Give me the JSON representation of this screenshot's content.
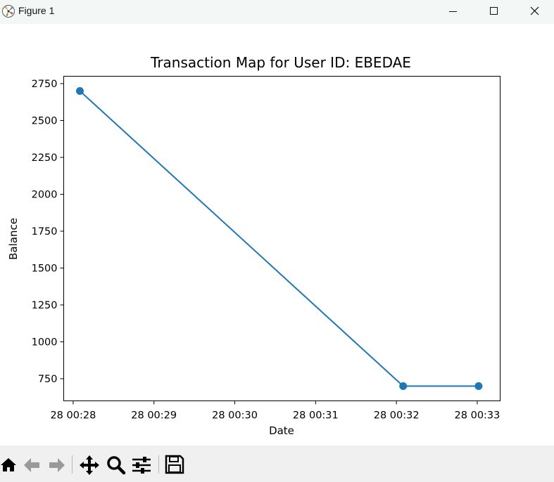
{
  "window": {
    "title": "Figure 1",
    "controls": {
      "minimize": "minimize-icon",
      "maximize": "maximize-icon",
      "close": "close-icon"
    }
  },
  "toolbar": {
    "tools": [
      {
        "id": "home",
        "icon": "home-icon"
      },
      {
        "id": "back",
        "icon": "arrow-left-icon"
      },
      {
        "id": "forward",
        "icon": "arrow-right-icon"
      },
      {
        "id": "pan",
        "icon": "move-icon"
      },
      {
        "id": "zoom",
        "icon": "magnifier-icon"
      },
      {
        "id": "configure",
        "icon": "sliders-icon"
      },
      {
        "id": "save",
        "icon": "floppy-disk-icon"
      }
    ]
  },
  "chart_data": {
    "type": "line",
    "title": "Transaction Map for User ID: EBEDAE",
    "xlabel": "Date",
    "ylabel": "Balance",
    "x": [
      "28 00:28:05",
      "28 00:32:05",
      "28 00:33:01"
    ],
    "series": [
      {
        "values": [
          2700,
          700,
          700
        ],
        "color": "#1f77b4",
        "marker": "circle"
      }
    ],
    "xticks": [
      "28 00:28",
      "28 00:29",
      "28 00:30",
      "28 00:31",
      "28 00:32",
      "28 00:33"
    ],
    "yticks": [
      750,
      1000,
      1250,
      1500,
      1750,
      2000,
      2250,
      2500,
      2750
    ],
    "xlim": [
      "28 00:27:53",
      "28 00:33:17"
    ],
    "ylim": [
      600,
      2800
    ],
    "grid": false,
    "legend": "none"
  }
}
